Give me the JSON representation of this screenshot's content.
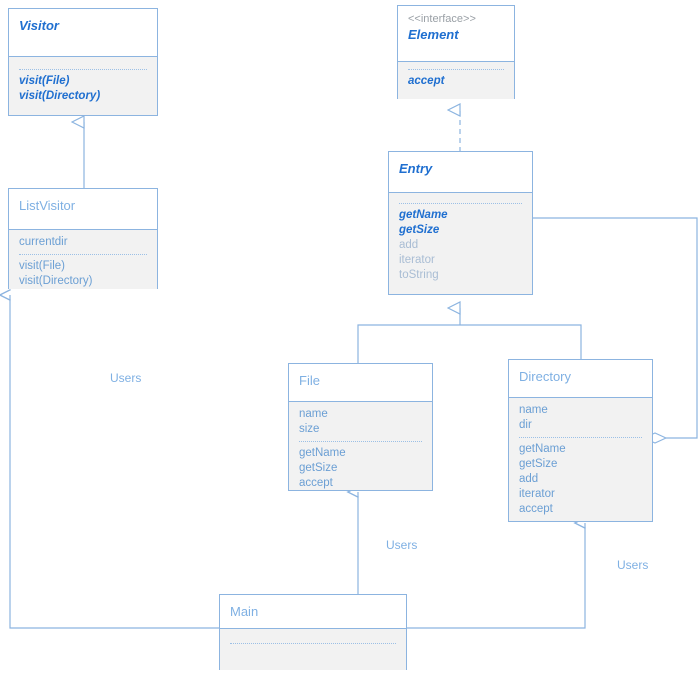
{
  "diagram": {
    "kind": "uml-class-diagram",
    "colors": {
      "line": "#8cb4e0",
      "abstract_text": "#1f6fd0",
      "member_text": "#6b9fd4",
      "muted_text": "#a9bdd4",
      "stereotype_text": "#9aa0a6",
      "body_fill": "#f2f2f2",
      "head_fill": "#ffffff",
      "label_text": "#7fb0e3"
    },
    "classes": [
      {
        "id": "visitor",
        "name": "Visitor",
        "stereotype": "",
        "abstract": true,
        "attributes": [],
        "methods": [
          {
            "label": "visit(File)",
            "abstract": true
          },
          {
            "label": "visit(Directory)",
            "abstract": true
          }
        ]
      },
      {
        "id": "element",
        "name": "Element",
        "stereotype": "<<interface>>",
        "abstract": true,
        "attributes": [],
        "methods": [
          {
            "label": "accept",
            "abstract": true
          }
        ]
      },
      {
        "id": "listvisitor",
        "name": "ListVisitor",
        "stereotype": "",
        "abstract": false,
        "attributes": [
          {
            "label": "currentdir",
            "abstract": false
          }
        ],
        "methods": [
          {
            "label": "visit(File)",
            "abstract": false
          },
          {
            "label": "visit(Directory)",
            "abstract": false
          }
        ]
      },
      {
        "id": "entry",
        "name": "Entry",
        "stereotype": "",
        "abstract": true,
        "attributes": [],
        "methods": [
          {
            "label": "getName",
            "abstract": true
          },
          {
            "label": "getSize",
            "abstract": true
          },
          {
            "label": "add",
            "abstract": false
          },
          {
            "label": "iterator",
            "abstract": false
          },
          {
            "label": "toString",
            "abstract": false
          }
        ]
      },
      {
        "id": "file",
        "name": "File",
        "stereotype": "",
        "abstract": false,
        "attributes": [
          {
            "label": "name",
            "abstract": false
          },
          {
            "label": "size",
            "abstract": false
          }
        ],
        "methods": [
          {
            "label": "getName",
            "abstract": false
          },
          {
            "label": "getSize",
            "abstract": false
          },
          {
            "label": "accept",
            "abstract": false
          }
        ]
      },
      {
        "id": "directory",
        "name": "Directory",
        "stereotype": "",
        "abstract": false,
        "attributes": [
          {
            "label": "name",
            "abstract": false
          },
          {
            "label": "dir",
            "abstract": false
          }
        ],
        "methods": [
          {
            "label": "getName",
            "abstract": false
          },
          {
            "label": "getSize",
            "abstract": false
          },
          {
            "label": "add",
            "abstract": false
          },
          {
            "label": "iterator",
            "abstract": false
          },
          {
            "label": "accept",
            "abstract": false
          }
        ]
      },
      {
        "id": "main",
        "name": "Main",
        "stereotype": "",
        "abstract": false,
        "attributes": [],
        "methods": []
      }
    ],
    "relationships": [
      {
        "id": "rel-listvisitor-visitor",
        "type": "generalization",
        "from": "listvisitor",
        "to": "visitor",
        "label": ""
      },
      {
        "id": "rel-entry-element",
        "type": "realization",
        "from": "entry",
        "to": "element",
        "label": ""
      },
      {
        "id": "rel-file-entry",
        "type": "generalization",
        "from": "file",
        "to": "entry",
        "label": ""
      },
      {
        "id": "rel-directory-entry",
        "type": "generalization",
        "from": "directory",
        "to": "entry",
        "label": ""
      },
      {
        "id": "rel-directory-entry-aggregation",
        "type": "aggregation",
        "from": "directory",
        "to": "entry",
        "label": ""
      },
      {
        "id": "rel-main-listvisitor",
        "type": "dependency",
        "from": "main",
        "to": "listvisitor",
        "label": "Users"
      },
      {
        "id": "rel-main-file",
        "type": "dependency",
        "from": "main",
        "to": "file",
        "label": "Users"
      },
      {
        "id": "rel-main-directory",
        "type": "dependency",
        "from": "main",
        "to": "directory",
        "label": "Users"
      }
    ],
    "labels": [
      {
        "id": "label-users-listvisitor",
        "text": "Users"
      },
      {
        "id": "label-users-file",
        "text": "Users"
      },
      {
        "id": "label-users-directory",
        "text": "Users"
      }
    ]
  }
}
